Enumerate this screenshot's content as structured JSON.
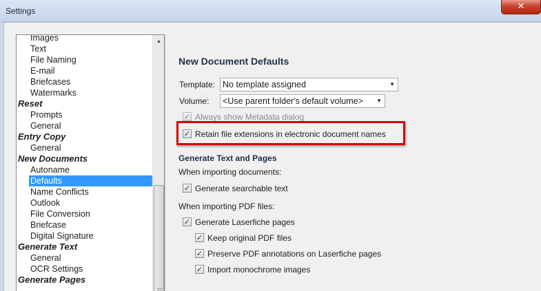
{
  "window": {
    "title": "Settings",
    "close_glyph": "✕"
  },
  "tree": {
    "items": [
      {
        "label": "Images",
        "level": "child"
      },
      {
        "label": "Text",
        "level": "child"
      },
      {
        "label": "File Naming",
        "level": "child"
      },
      {
        "label": "E-mail",
        "level": "child"
      },
      {
        "label": "Briefcases",
        "level": "child"
      },
      {
        "label": "Watermarks",
        "level": "child"
      },
      {
        "label": "Reset",
        "level": "group"
      },
      {
        "label": "Prompts",
        "level": "child"
      },
      {
        "label": "General",
        "level": "child"
      },
      {
        "label": "Entry Copy",
        "level": "group"
      },
      {
        "label": "General",
        "level": "child"
      },
      {
        "label": "New Documents",
        "level": "group"
      },
      {
        "label": "Autoname",
        "level": "child"
      },
      {
        "label": "Defaults",
        "level": "child",
        "selected": true
      },
      {
        "label": "Name Conflicts",
        "level": "child"
      },
      {
        "label": "Outlook",
        "level": "child"
      },
      {
        "label": "File Conversion",
        "level": "child"
      },
      {
        "label": "Briefcase",
        "level": "child"
      },
      {
        "label": "Digital Signature",
        "level": "child"
      },
      {
        "label": "Generate Text",
        "level": "group"
      },
      {
        "label": "General",
        "level": "child"
      },
      {
        "label": "OCR Settings",
        "level": "child"
      },
      {
        "label": "Generate Pages",
        "level": "group"
      }
    ]
  },
  "panel": {
    "section_title": "New Document Defaults",
    "template_label": "Template:",
    "template_value": "No template assigned",
    "volume_label": "Volume:",
    "volume_value": "<Use parent folder's default volume>",
    "always_show_metadata": "Always show Metadata dialog",
    "retain_extensions": "Retain file extensions in electronic document names",
    "generate_heading": "Generate Text and Pages",
    "importing_docs": "When importing documents:",
    "generate_searchable": "Generate searchable text",
    "importing_pdf": "When importing PDF files:",
    "generate_laserfiche": "Generate Laserfiche pages",
    "keep_original": "Keep original PDF files",
    "preserve_annotations": "Preserve PDF annotations on Laserfiche pages",
    "import_monochrome": "Import monochrome images"
  },
  "glyphs": {
    "check": "✓",
    "dropdown_arrow": "▼",
    "scroll_up": "▲"
  },
  "colors": {
    "selection": "#3399ff",
    "highlight_border": "#d90000"
  }
}
